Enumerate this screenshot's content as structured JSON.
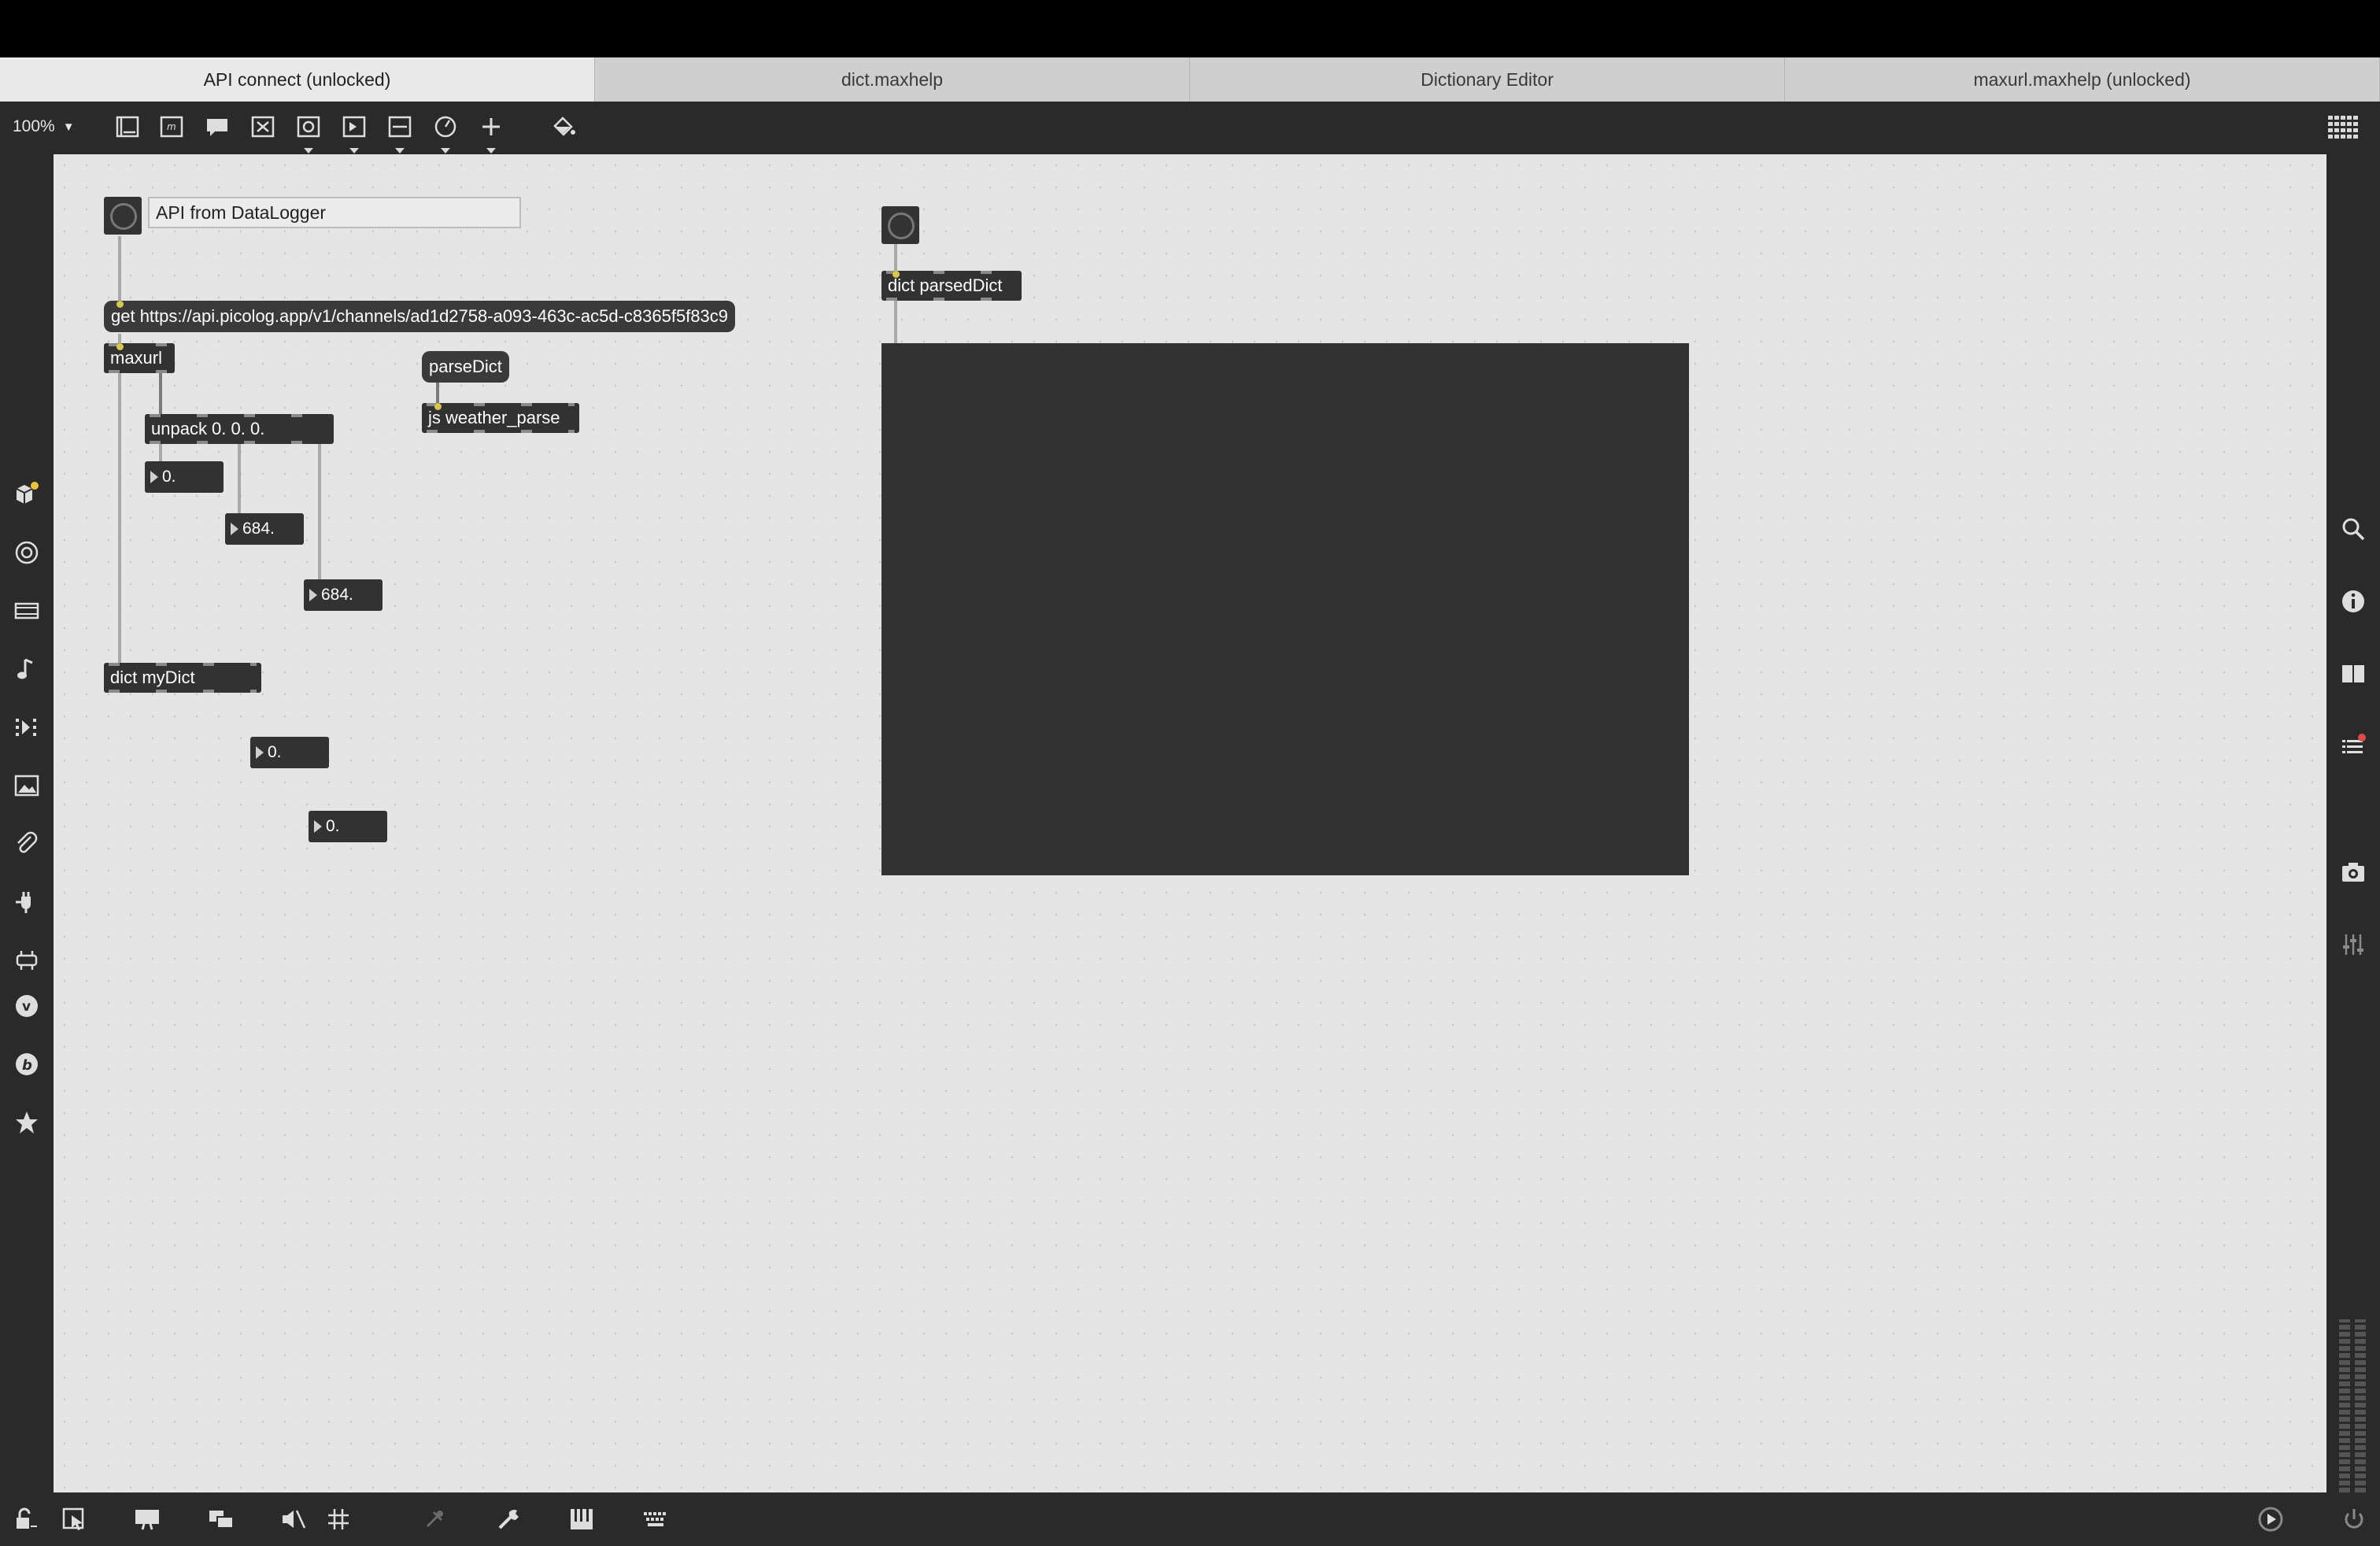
{
  "tabs": [
    {
      "label": "API connect (unlocked)",
      "active": true
    },
    {
      "label": "dict.maxhelp",
      "active": false
    },
    {
      "label": "Dictionary Editor",
      "active": false
    },
    {
      "label": "maxurl.maxhelp (unlocked)",
      "active": false
    }
  ],
  "toolbar": {
    "zoom": "100%",
    "icons": [
      "presentation-icon",
      "object-icon",
      "comment-icon",
      "message-icon",
      "toggle-icon",
      "button-icon",
      "slider-icon",
      "dial-icon",
      "add-icon",
      "paint-bucket-icon"
    ]
  },
  "patch": {
    "comment": "API from DataLogger",
    "get_message": "get https://api.picolog.app/v1/channels/ad1d2758-a093-463c-ac5d-c8365f5f83c9",
    "maxurl": "maxurl",
    "unpack": "unpack 0. 0. 0.",
    "parse_message": "parseDict",
    "js_object": "js weather_parse",
    "dict_mydict": "dict myDict",
    "dict_parsed": "dict parsedDict",
    "numbers": {
      "n1": "0.",
      "n2": "684.",
      "n3": "684.",
      "n4": "0.",
      "n5": "0."
    }
  },
  "left_sidebar_icons": [
    "packages-icon",
    "target-icon",
    "video-icon",
    "music-note-icon",
    "sequence-icon",
    "image-icon",
    "paperclip-icon",
    "plug-icon",
    "connector-icon",
    "vizzie-icon",
    "beap-icon",
    "star-icon"
  ],
  "right_sidebar_icons": [
    "search-icon",
    "info-icon",
    "columns-icon",
    "list-icon",
    "snapshot-icon",
    "mixer-icon"
  ],
  "colors": {
    "chrome": "#2a2a2a",
    "canvas": "#e5e5e5",
    "object": "#323232",
    "accent": "#d6c84d"
  }
}
